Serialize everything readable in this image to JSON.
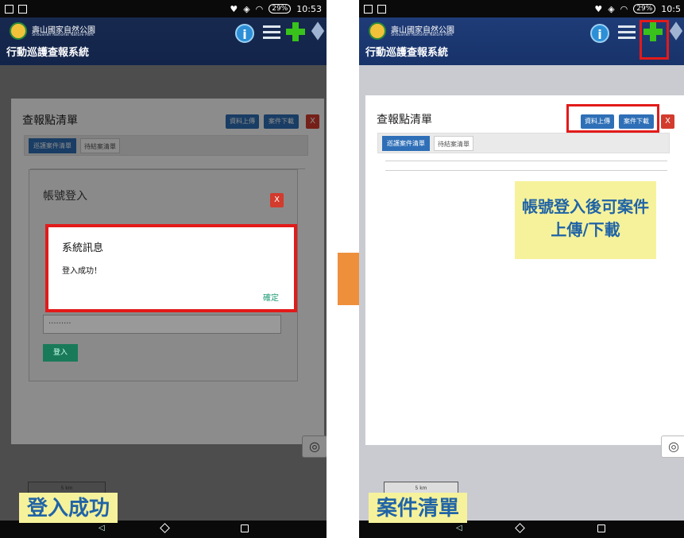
{
  "status_bar": {
    "time": "10:53",
    "battery": "29%",
    "time_right": "10:5"
  },
  "app": {
    "park_name": "壽山國家自然公園",
    "park_name_en": "Shoushan National Nature Park",
    "title": "行動巡護查報系統"
  },
  "panel": {
    "title": "查報點清單",
    "upload_label": "資料上傳",
    "download_label": "案件下載",
    "close_label": "X",
    "tabs": [
      {
        "label": "巡護案件清單"
      },
      {
        "label": "待結案清單"
      }
    ]
  },
  "login": {
    "title": "帳號登入",
    "close_label": "X",
    "password_value": "·········",
    "submit_label": "登入"
  },
  "dialog": {
    "title": "系統訊息",
    "message": "登入成功！",
    "ok_label": "確定"
  },
  "map": {
    "scale_label": "5 km",
    "locate_icon": "◎"
  },
  "captions": {
    "left": "登入成功",
    "right": "案件清單",
    "note": "帳號登入後可案件上傳/下載"
  },
  "colors": {
    "highlight": "#e31a1a",
    "note_bg": "#f6f29b",
    "note_text": "#2164a6",
    "primary": "#2e6fb7"
  }
}
